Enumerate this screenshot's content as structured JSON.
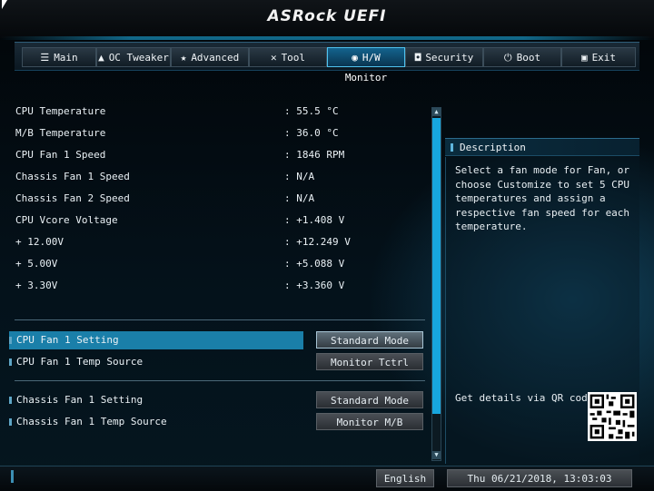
{
  "brand": {
    "logo_text": "ASRock UEFI"
  },
  "nav": {
    "tabs": [
      {
        "label": "Main",
        "icon": "list-icon"
      },
      {
        "label": "OC Tweaker",
        "icon": "rocket-icon"
      },
      {
        "label": "Advanced",
        "icon": "star-icon"
      },
      {
        "label": "Tool",
        "icon": "tools-icon"
      },
      {
        "label": "H/W Monitor",
        "icon": "monitor-icon",
        "active": true
      },
      {
        "label": "Security",
        "icon": "shield-icon"
      },
      {
        "label": "Boot",
        "icon": "power-icon"
      },
      {
        "label": "Exit",
        "icon": "exit-icon"
      }
    ]
  },
  "readings": [
    {
      "label": "CPU Temperature",
      "value": ": 55.5 °C"
    },
    {
      "label": "M/B Temperature",
      "value": ": 36.0 °C"
    },
    {
      "label": "CPU Fan 1 Speed",
      "value": ": 1846 RPM"
    },
    {
      "label": "Chassis Fan 1 Speed",
      "value": ": N/A"
    },
    {
      "label": "Chassis Fan 2 Speed",
      "value": ": N/A"
    },
    {
      "label": "CPU Vcore Voltage",
      "value": ": +1.408 V"
    },
    {
      "label": "+ 12.00V",
      "value": ": +12.249 V"
    },
    {
      "label": "+ 5.00V",
      "value": ": +5.088 V"
    },
    {
      "label": "+ 3.30V",
      "value": ": +3.360 V"
    }
  ],
  "settings": [
    {
      "label": "CPU Fan 1 Setting",
      "value": "Standard Mode",
      "selected": true
    },
    {
      "label": "CPU Fan 1 Temp Source",
      "value": "Monitor Tctrl"
    },
    {
      "label": "Chassis Fan 1 Setting",
      "value": "Standard Mode"
    },
    {
      "label": "Chassis Fan 1 Temp Source",
      "value": "Monitor M/B"
    }
  ],
  "description": {
    "title": "Description",
    "text": "Select a fan mode for Fan, or choose Customize to set 5 CPU temperatures and assign a respective fan speed for each temperature.",
    "qr_label": "Get details via QR code"
  },
  "footer": {
    "language": "English",
    "datetime": "Thu 06/21/2018, 13:03:03"
  },
  "colors": {
    "accent": "#17a6de",
    "selected_row": "#1a7fa9"
  }
}
